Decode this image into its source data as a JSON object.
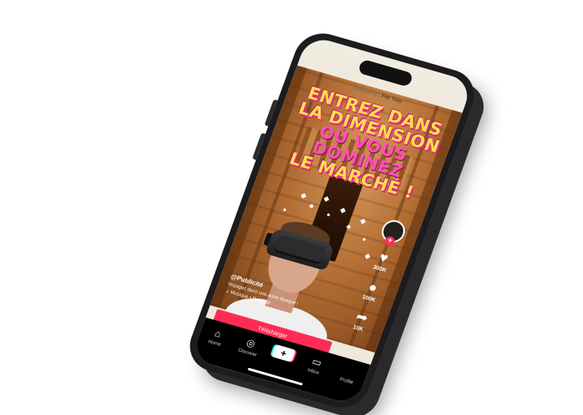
{
  "top_tabs": {
    "following": "Following",
    "separator": "|",
    "for_you": "For You"
  },
  "headline": {
    "line1": "ENTREZ DANS",
    "line2": "LA DIMENSION",
    "line3": "OÙ VOUS DOMINEZ",
    "line4": "LE MARCHÉ !"
  },
  "caption": {
    "handle": "@Publicité",
    "description": "Voyagez dans une autre époque !",
    "music": "♫ Musique • Publicité"
  },
  "actions": {
    "like_count": "300K",
    "comment_count": "100K",
    "share_count": "10K"
  },
  "cta": {
    "label": "Télécharger"
  },
  "nav": {
    "home": "Home",
    "discover": "Discover",
    "create": "+",
    "inbox": "Inbox",
    "profile": "Profile"
  },
  "colors": {
    "accent": "#fe2c55",
    "headline_yellow": "#ffdf4a",
    "headline_pink": "#e8218c"
  }
}
